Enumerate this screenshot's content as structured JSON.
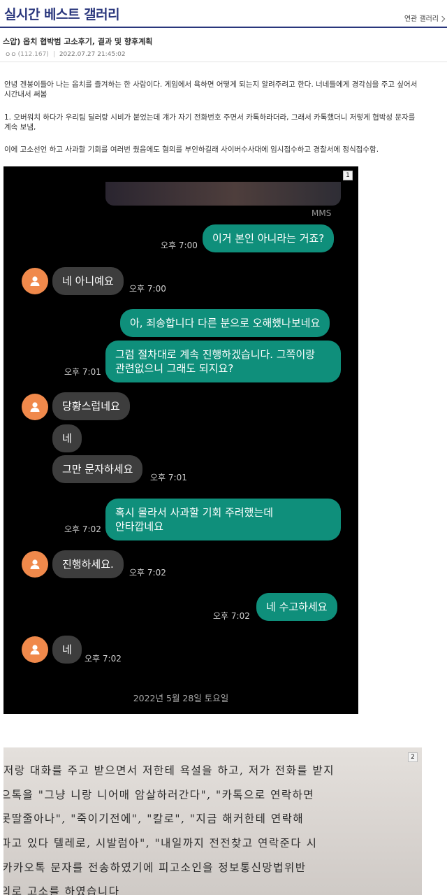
{
  "header": {
    "gallery_title": "실시간 베스트 갤러리",
    "related_link": "연관 갤러리"
  },
  "post": {
    "title": "스압) 옵치 협박범 고소후기, 결과 및 향후계획",
    "author": "ㅇㅇ",
    "ip": "(112.167)",
    "datetime": "2022.07.27 21:45:02"
  },
  "body": {
    "paragraph1_line1": "안녕 겐붕이들아 나는 옵치를 즐겨하는 한 사람이다. 게임에서 욕하면 어떻게 되는지 알려주려고 한다. 너네들에게 경각심을 주고 싶어서",
    "paragraph1_line2": "시간내서 써봄",
    "paragraph2_line1": "1. 오버워치 하다가 우리팀 딜러랑 시비가 붙었는데 걔가 자기 전화번호 주면서 카톡하라더라, 그래서 카톡했더니 저렇게 협박성 문자를",
    "paragraph2_line2": "계속 보냄,",
    "paragraph3": "이에 고소선언 하고 사과할 기회를 여러번 줬음에도 혐의를 부인하길래 사이버수사대에 임시접수하고 경찰서에 정식접수함."
  },
  "image1": {
    "badge": "1",
    "mms_label": "MMS",
    "messages": [
      {
        "from": "me",
        "text": "이거 본인 아니라는 거죠?",
        "time": "오후 7:00"
      },
      {
        "from": "them",
        "text": "네 아니예요",
        "time": "오후 7:00"
      },
      {
        "from": "me",
        "text": "아, 죄송합니다 다른 분으로 오해했나보네요",
        "time": ""
      },
      {
        "from": "me",
        "text_line1": "그럼 절차대로 계속 진행하겠습니다. 그쪽이랑",
        "text_line2": "관련없으니 그래도 되지요?",
        "time": "오후 7:01"
      },
      {
        "from": "them",
        "text": "당황스럽네요",
        "time": ""
      },
      {
        "from": "them",
        "text": "네",
        "time": ""
      },
      {
        "from": "them",
        "text": "그만 문자하세요",
        "time": "오후 7:01"
      },
      {
        "from": "me",
        "text_line1": "혹시 몰라서 사과할 기회 주려했는데",
        "text_line2": "안타깝네요",
        "time": "오후 7:02"
      },
      {
        "from": "them",
        "text": "진행하세요.",
        "time": "오후 7:02"
      },
      {
        "from": "me",
        "text": "네 수고하세요",
        "time": "오후 7:02"
      },
      {
        "from": "them",
        "text": "네",
        "time": "오후 7:02"
      }
    ],
    "date_divider": "2022년 5월 28일 토요일"
  },
  "image2": {
    "badge": "2",
    "lines": [
      "저랑 대화를 주고 받으면서 저한테 욕설을 하고, 저가 전화를 받지",
      "으톡을 \"그냥 니랑 니어매 암살하러간다\", \"카톡으로 연락하면",
      "못딸줄아나\", \"죽이기전에\", \"칼로\", \"지금 해커한테 연락해",
      "파고 있다 텔레로, 시발럼아\", \"내일까지 전전찾고 연락준다 시",
      "카카오톡 문자를 전송하였기에 피고소인을 정보통신망법위반",
      "의로 고소를 하였습니다"
    ]
  },
  "colors": {
    "brand": "#29367c",
    "my_bubble": "#0f8f7b",
    "their_bubble": "#3d3d3d",
    "avatar": "#f0894b"
  }
}
